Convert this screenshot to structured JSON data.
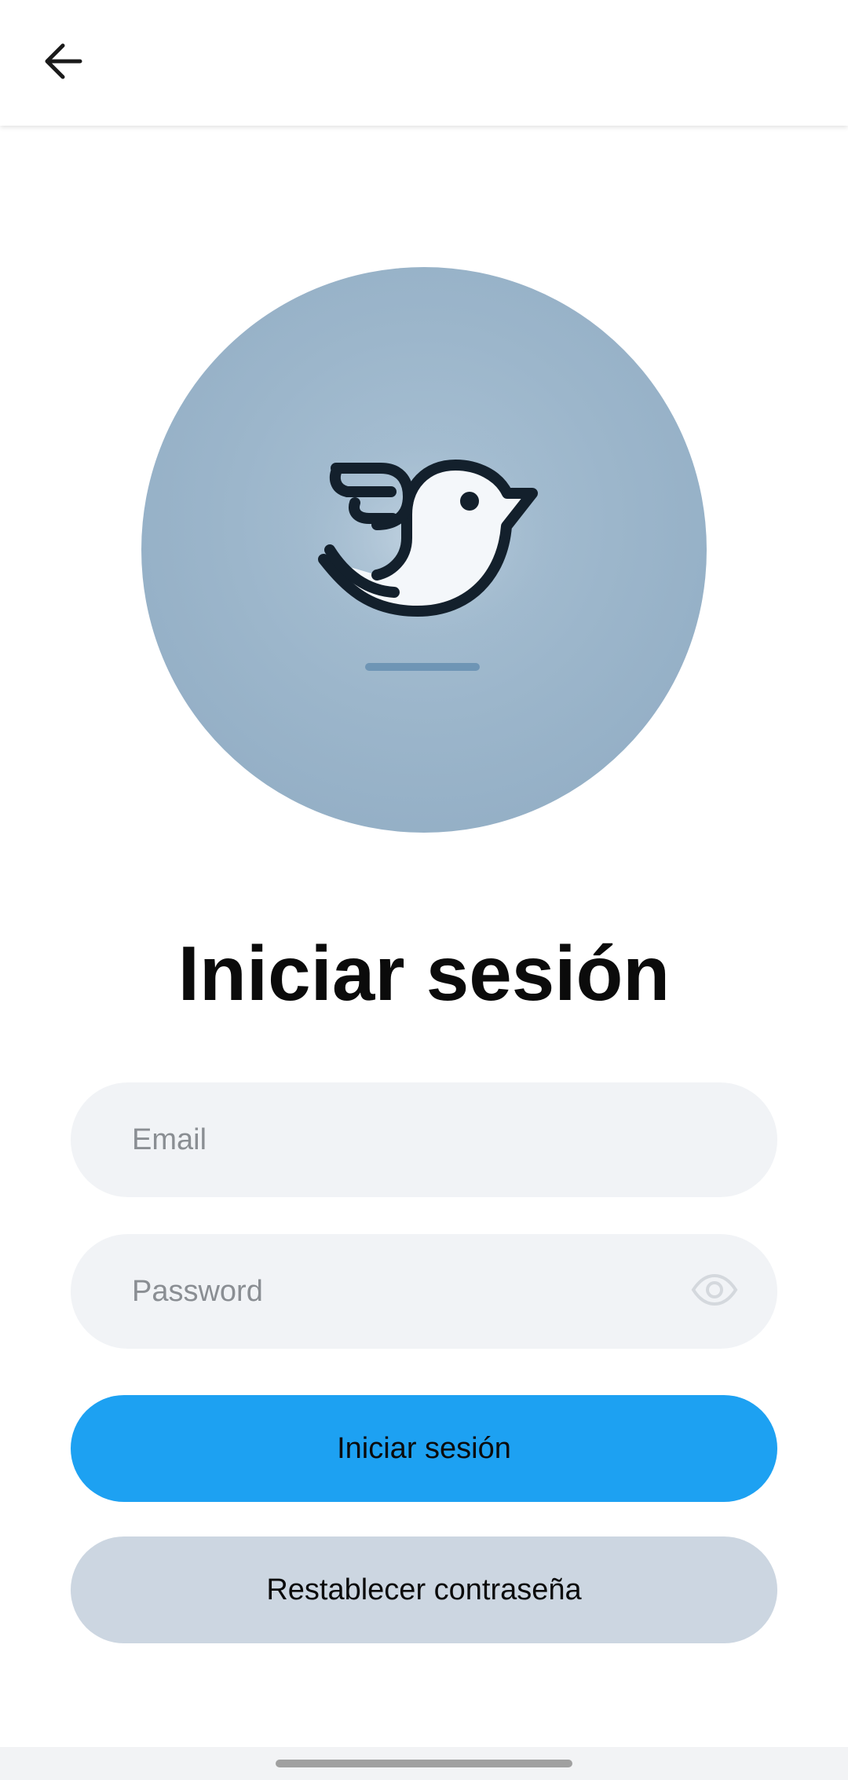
{
  "app_bar": {
    "back_icon": "arrow-left-icon"
  },
  "logo": {
    "icon": "bird-logo-icon",
    "colors": {
      "circle": "#9cb6cb",
      "bird_outline": "#13202c",
      "bird_body": "#f4f7fa",
      "underline": "#6e95b5"
    }
  },
  "title": "Iniciar sesión",
  "email_field": {
    "value": "",
    "placeholder": "Email"
  },
  "password_field": {
    "value": "",
    "placeholder": "Password",
    "toggle_icon": "eye-icon"
  },
  "buttons": {
    "login_label": "Iniciar sesión",
    "reset_label": "Restablecer contraseña"
  },
  "colors": {
    "primary": "#1da1f2",
    "secondary": "#ccd6e1",
    "field_bg": "#f1f3f6",
    "text": "#0b0b0b",
    "placeholder": "#8a8e93"
  }
}
